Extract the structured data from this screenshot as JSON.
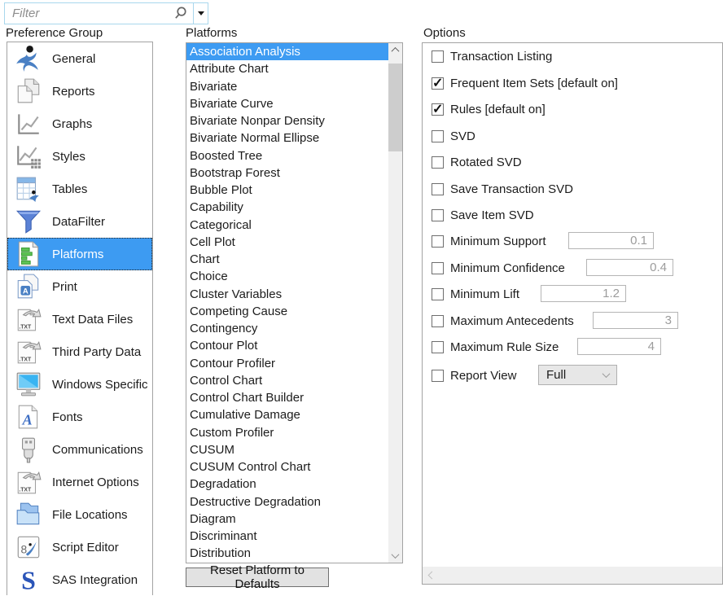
{
  "filter": {
    "placeholder": "Filter"
  },
  "headings": {
    "preference_group": "Preference Group",
    "platforms": "Platforms",
    "options": "Options"
  },
  "sidebar": {
    "items": [
      {
        "label": "General",
        "icon": "person-icon",
        "selected": false
      },
      {
        "label": "Reports",
        "icon": "pages-icon",
        "selected": false
      },
      {
        "label": "Graphs",
        "icon": "line-chart-icon",
        "selected": false
      },
      {
        "label": "Styles",
        "icon": "chart-styles-icon",
        "selected": false
      },
      {
        "label": "Tables",
        "icon": "table-icon",
        "selected": false
      },
      {
        "label": "DataFilter",
        "icon": "funnel-icon",
        "selected": false
      },
      {
        "label": "Platforms",
        "icon": "bar-chart-page-icon",
        "selected": true
      },
      {
        "label": "Print",
        "icon": "print-pages-icon",
        "selected": false
      },
      {
        "label": "Text Data Files",
        "icon": "txt-file-icon",
        "selected": false
      },
      {
        "label": "Third Party Data",
        "icon": "txt-file-icon",
        "selected": false
      },
      {
        "label": "Windows Specific",
        "icon": "monitor-icon",
        "selected": false
      },
      {
        "label": "Fonts",
        "icon": "font-page-icon",
        "selected": false
      },
      {
        "label": "Communications",
        "icon": "usb-icon",
        "selected": false
      },
      {
        "label": "Internet Options",
        "icon": "txt-file-icon",
        "selected": false
      },
      {
        "label": "File Locations",
        "icon": "folders-icon",
        "selected": false
      },
      {
        "label": "Script Editor",
        "icon": "script-editor-icon",
        "selected": false
      },
      {
        "label": "SAS Integration",
        "icon": "sas-icon",
        "selected": false
      }
    ]
  },
  "platform_list": {
    "selected_index": 0,
    "items": [
      "Association Analysis",
      "Attribute Chart",
      "Bivariate",
      "Bivariate Curve",
      "Bivariate Nonpar Density",
      "Bivariate Normal Ellipse",
      "Boosted Tree",
      "Bootstrap Forest",
      "Bubble Plot",
      "Capability",
      "Categorical",
      "Cell Plot",
      "Chart",
      "Choice",
      "Cluster Variables",
      "Competing Cause",
      "Contingency",
      "Contour Plot",
      "Contour Profiler",
      "Control Chart",
      "Control Chart Builder",
      "Cumulative Damage",
      "Custom Profiler",
      "CUSUM",
      "CUSUM Control Chart",
      "Degradation",
      "Destructive Degradation",
      "Diagram",
      "Discriminant",
      "Distribution"
    ]
  },
  "reset_button": {
    "label": "Reset Platform to Defaults"
  },
  "options_panel": {
    "rows": [
      {
        "label": "Transaction Listing",
        "checked": false
      },
      {
        "label": "Frequent Item Sets [default on]",
        "checked": true
      },
      {
        "label": "Rules [default on]",
        "checked": true
      },
      {
        "label": "SVD",
        "checked": false
      },
      {
        "label": "Rotated SVD",
        "checked": false
      },
      {
        "label": "Save Transaction SVD",
        "checked": false
      },
      {
        "label": "Save Item SVD",
        "checked": false
      },
      {
        "label": "Minimum Support",
        "checked": false,
        "input_value": "0.1"
      },
      {
        "label": "Minimum Confidence",
        "checked": false,
        "input_value": "0.4"
      },
      {
        "label": "Minimum Lift",
        "checked": false,
        "input_value": "1.2"
      },
      {
        "label": "Maximum Antecedents",
        "checked": false,
        "input_value": "3"
      },
      {
        "label": "Maximum Rule Size",
        "checked": false,
        "input_value": "4"
      },
      {
        "label": "Report View",
        "checked": false,
        "dropdown_value": "Full"
      }
    ]
  },
  "colors": {
    "selection_blue": "#3d9bf2",
    "filter_border": "#a9d7ed",
    "button_face": "#e2e2e2"
  }
}
